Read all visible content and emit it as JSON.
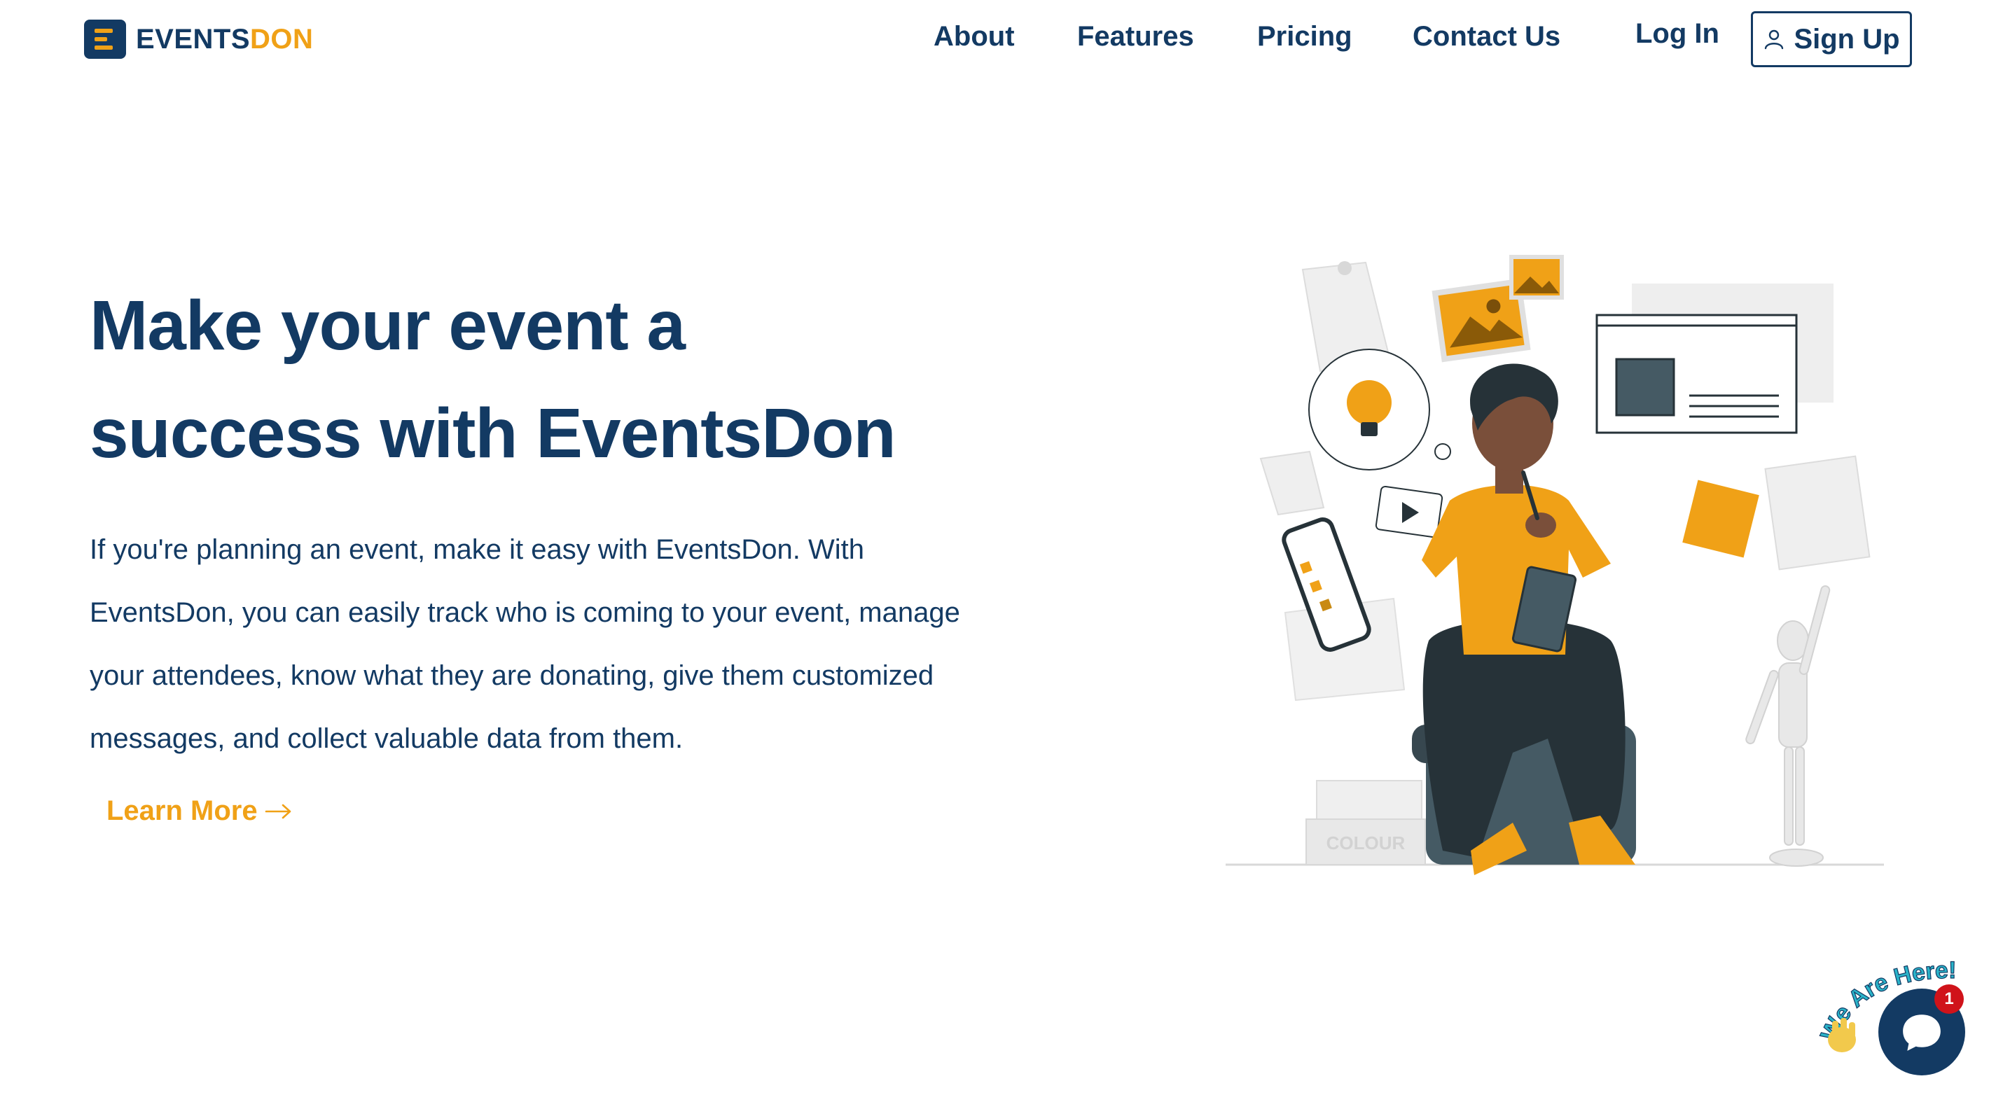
{
  "brand": {
    "name_part1": "EVENTS",
    "name_part2": "DON"
  },
  "nav": {
    "about": "About",
    "features": "Features",
    "pricing": "Pricing",
    "contact": "Contact Us",
    "login": "Log In",
    "signup": "Sign Up"
  },
  "hero": {
    "title_line1": "Make your event a",
    "title_line2": "success with EventsDon",
    "description": "If you're planning an event, make it easy with EventsDon. With EventsDon, you can easily track who is coming to your event, manage your attendees, know what they are donating, give them customized messages, and collect valuable data from them.",
    "cta": "Learn More"
  },
  "illustration": {
    "book_label": "COLOUR"
  },
  "chat": {
    "greeting": "We Are Here!",
    "badge_count": "1"
  },
  "colors": {
    "primary": "#133a63",
    "accent": "#f0a117",
    "skin": "#7a4f3a",
    "dark": "#263238",
    "badge": "#d0131a"
  },
  "icons": [
    "logo-icon",
    "user-icon",
    "arrow-right-icon",
    "lightbulb-icon",
    "play-icon",
    "chat-icon",
    "wave-hand-icon"
  ]
}
